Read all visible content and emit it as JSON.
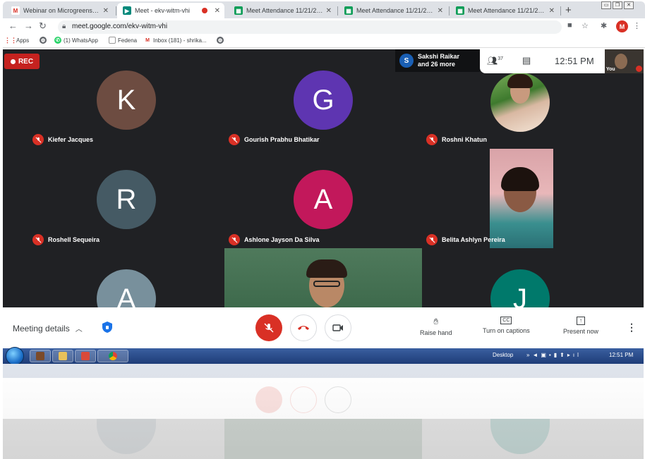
{
  "browser": {
    "tabs": [
      {
        "title": "Webinar on Microgreens - shrik",
        "icon": "gmail-icon",
        "active": false
      },
      {
        "title": "Meet - ekv-witm-vhi",
        "icon": "meet-icon",
        "active": true
      },
      {
        "title": "Meet Attendance 11/21/2020 - ",
        "icon": "sheets-icon",
        "active": false
      },
      {
        "title": "Meet Attendance 11/21/2020 - ",
        "icon": "sheets-icon",
        "active": false
      },
      {
        "title": "Meet Attendance 11/21/2020 - ",
        "icon": "sheets-icon",
        "active": false
      }
    ],
    "new_tab": "+",
    "url": "meet.google.com/ekv-witm-vhi",
    "profile_initial": "M",
    "bookmarks": [
      {
        "label": "Apps",
        "icon": "apps-grid-icon"
      },
      {
        "label": "",
        "icon": "globe-icon"
      },
      {
        "label": "(1) WhatsApp",
        "icon": "whatsapp-icon"
      },
      {
        "label": "Fedena",
        "icon": "document-icon"
      },
      {
        "label": "Inbox (181) - shrika...",
        "icon": "gmail-icon"
      },
      {
        "label": "",
        "icon": "globe-icon"
      }
    ]
  },
  "meet": {
    "rec_label": "REC",
    "active_speaker": {
      "initial": "S",
      "line1": "Sakshi Raikar",
      "line2": "and 26 more"
    },
    "participant_count": "37",
    "time": "12:51 PM",
    "self_label": "You",
    "participants": [
      {
        "name": "Kiefer Jacques",
        "initial": "K",
        "color": "#6d4c41",
        "muted": true
      },
      {
        "name": "Gourish Prabhu Bhatikar",
        "initial": "G",
        "color": "#5e35b1",
        "muted": true
      },
      {
        "name": "Roshni Khatun",
        "initial": "",
        "color": "",
        "muted": true
      },
      {
        "name": "Roshell Sequeira",
        "initial": "R",
        "color": "#455a64",
        "muted": true
      },
      {
        "name": "Ashlone Jayson Da Silva",
        "initial": "A",
        "color": "#c2185b",
        "muted": true
      },
      {
        "name": "Belita Ashlyn Pereira",
        "initial": "",
        "color": "",
        "muted": true
      },
      {
        "name": "",
        "initial": "A",
        "color": "#78909c",
        "muted": false
      },
      {
        "name": "",
        "initial": "",
        "color": "",
        "muted": false
      },
      {
        "name": "",
        "initial": "J",
        "color": "#00796b",
        "muted": false
      }
    ],
    "controls": {
      "meeting_details": "Meeting details",
      "raise_hand": "Raise hand",
      "captions": "Turn on captions",
      "present": "Present now"
    }
  },
  "taskbar": {
    "desktop_label": "Desktop",
    "clock": "12:51 PM"
  }
}
